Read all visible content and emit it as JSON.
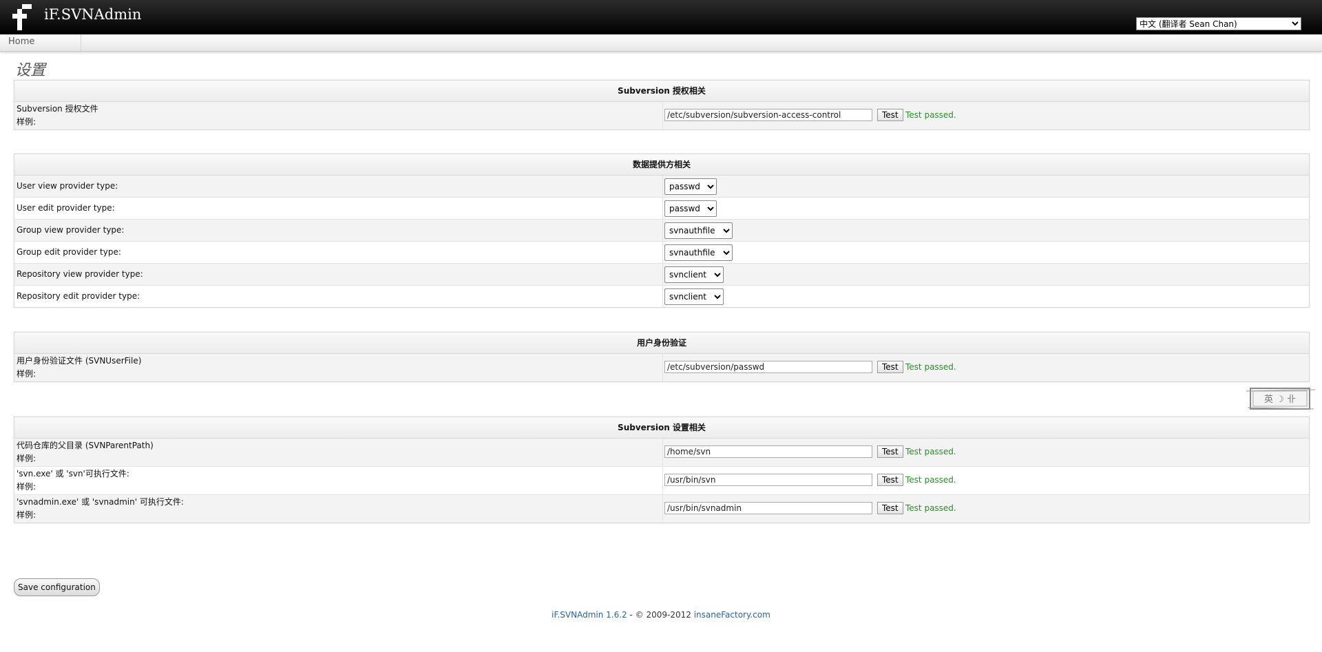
{
  "header": {
    "app_title": "iF.SVNAdmin",
    "language_selected": "中文 (翻译者 Sean Chan)"
  },
  "nav": {
    "home": "Home"
  },
  "page_title": "设置",
  "sections": {
    "auth_file": {
      "title": "Subversion 授权相关",
      "rows": [
        {
          "label": "Subversion 授权文件",
          "sub": "样例:",
          "value": "/etc/subversion/subversion-access-control",
          "test_label": "Test",
          "result": "Test passed."
        }
      ]
    },
    "providers": {
      "title": "数据提供方相关",
      "rows": [
        {
          "label": "User view provider type:",
          "value": "passwd"
        },
        {
          "label": "User edit provider type:",
          "value": "passwd"
        },
        {
          "label": "Group view provider type:",
          "value": "svnauthfile"
        },
        {
          "label": "Group edit provider type:",
          "value": "svnauthfile"
        },
        {
          "label": "Repository view provider type:",
          "value": "svnclient"
        },
        {
          "label": "Repository edit provider type:",
          "value": "svnclient"
        }
      ]
    },
    "user_auth": {
      "title": "用户身份验证",
      "rows": [
        {
          "label": "用户身份验证文件 (SVNUserFile)",
          "sub": "样例:",
          "value": "/etc/subversion/passwd",
          "test_label": "Test",
          "result": "Test passed."
        }
      ]
    },
    "svn_settings": {
      "title": "Subversion 设置相关",
      "rows": [
        {
          "label": "代码仓库的父目录 (SVNParentPath)",
          "sub": "样例:",
          "value": "/home/svn",
          "test_label": "Test",
          "result": "Test passed."
        },
        {
          "label": "'svn.exe' 或 'svn'可执行文件:",
          "sub": "样例:",
          "value": "/usr/bin/svn",
          "test_label": "Test",
          "result": "Test passed."
        },
        {
          "label": "'svnadmin.exe' 或 'svnadmin' 可执行文件:",
          "sub": "样例:",
          "value": "/usr/bin/svnadmin",
          "test_label": "Test",
          "result": "Test passed."
        }
      ]
    }
  },
  "stamp_text": "英 ☽ 卝",
  "save_label": "Save configuration",
  "footer": {
    "product": "iF.SVNAdmin 1.6.2",
    "middle": " - © 2009-2012 ",
    "vendor": "insaneFactory.com"
  }
}
